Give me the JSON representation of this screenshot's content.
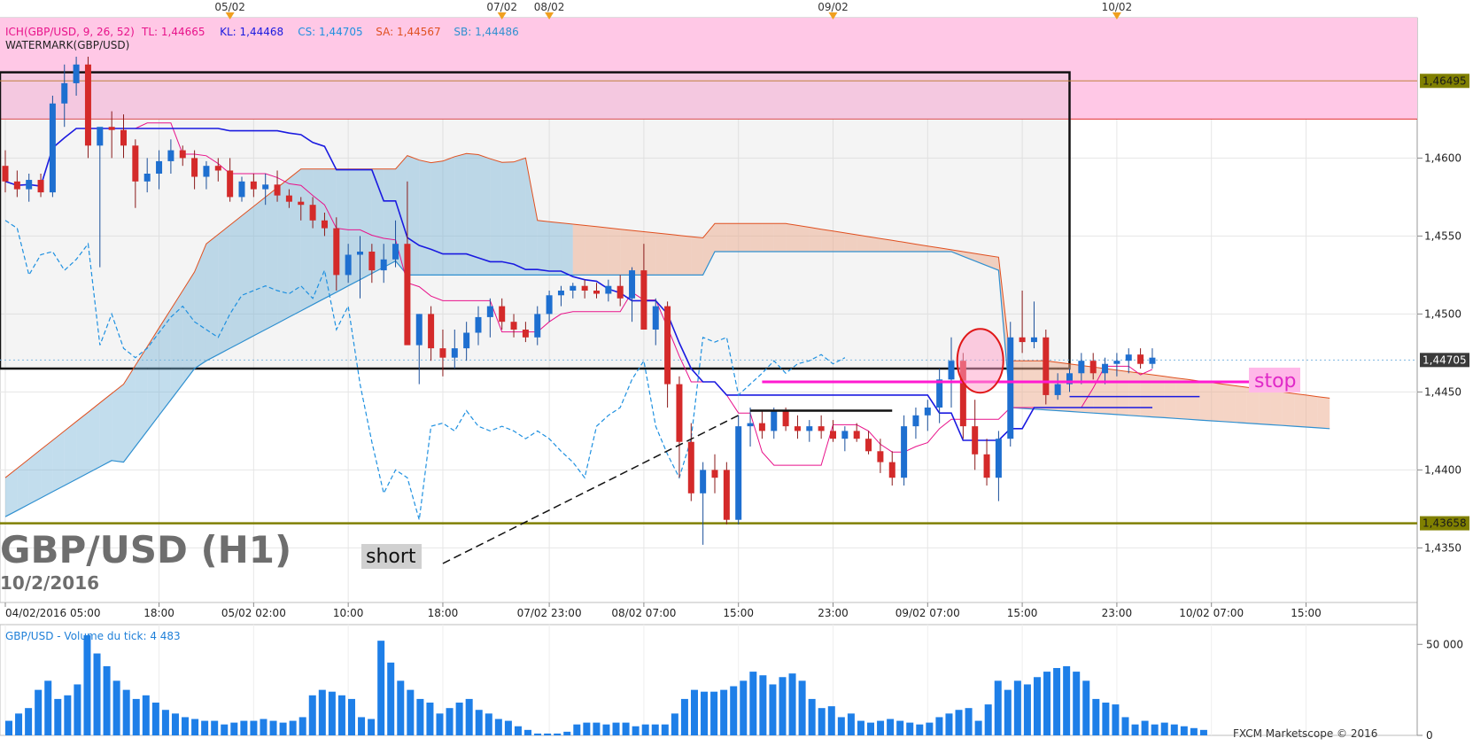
{
  "chart_data": {
    "type": "candlestick",
    "symbol_title": "GBP/USD (H1)",
    "date_label": "10/2/2016",
    "indicator_line": {
      "name": "ICH(GBP/USD, 9, 26, 52)",
      "items": [
        {
          "label": "TL: 1,44665",
          "color": "#e8128a"
        },
        {
          "label": "KL: 1,44468",
          "color": "#1a1ae0"
        },
        {
          "label": "CS: 1,44705",
          "color": "#1e90e0"
        },
        {
          "label": "SA: 1,44567",
          "color": "#e05020"
        },
        {
          "label": "SB: 1,44486",
          "color": "#3090d0"
        }
      ]
    },
    "watermark_label": "WATERMARK(GBP/USD)",
    "y_axis": {
      "min": 1.4315,
      "max": 1.469,
      "ticks": [
        "1,4350",
        "1,4400",
        "1,4450",
        "1,4500",
        "1,4550",
        "1,4600"
      ],
      "tick_values": [
        1.435,
        1.44,
        1.445,
        1.45,
        1.455,
        1.46
      ]
    },
    "price_tags": [
      {
        "label": "1,46495",
        "value": 1.46495,
        "style": "olive"
      },
      {
        "label": "1,44705",
        "value": 1.44705,
        "style": "dark"
      },
      {
        "label": "1,43658",
        "value": 1.43658,
        "style": "olive"
      }
    ],
    "x_axis_labels": [
      {
        "label": "04/02/2016 05:00",
        "bar": 0
      },
      {
        "label": "18:00",
        "bar": 13
      },
      {
        "label": "05/02 02:00",
        "bar": 21
      },
      {
        "label": "10:00",
        "bar": 29
      },
      {
        "label": "18:00",
        "bar": 37
      },
      {
        "label": "07/02 23:00",
        "bar": 46
      },
      {
        "label": "08/02 07:00",
        "bar": 54
      },
      {
        "label": "15:00",
        "bar": 62
      },
      {
        "label": "23:00",
        "bar": 70
      },
      {
        "label": "09/02 07:00",
        "bar": 78
      },
      {
        "label": "15:00",
        "bar": 86
      },
      {
        "label": "23:00",
        "bar": 94
      },
      {
        "label": "10/02 07:00",
        "bar": 102
      },
      {
        "label": "15:00",
        "bar": 110
      }
    ],
    "top_date_markers": [
      {
        "label": "05/02",
        "bar": 19
      },
      {
        "label": "07/02",
        "bar": 42
      },
      {
        "label": "08/02",
        "bar": 46
      },
      {
        "label": "09/02",
        "bar": 70
      },
      {
        "label": "10/02",
        "bar": 94
      }
    ],
    "candles_ohlc": [
      [
        1.4595,
        1.4605,
        1.4578,
        1.4585
      ],
      [
        1.4585,
        1.4592,
        1.4575,
        1.458
      ],
      [
        1.458,
        1.459,
        1.4572,
        1.4586
      ],
      [
        1.4586,
        1.459,
        1.4575,
        1.4578
      ],
      [
        1.4578,
        1.464,
        1.4575,
        1.4635
      ],
      [
        1.4635,
        1.466,
        1.462,
        1.4648
      ],
      [
        1.4648,
        1.4665,
        1.464,
        1.466
      ],
      [
        1.466,
        1.4665,
        1.46,
        1.4608
      ],
      [
        1.4608,
        1.4618,
        1.453,
        1.462
      ],
      [
        1.462,
        1.463,
        1.46,
        1.4618
      ],
      [
        1.4618,
        1.4628,
        1.46,
        1.4608
      ],
      [
        1.4608,
        1.4612,
        1.4568,
        1.4585
      ],
      [
        1.4585,
        1.46,
        1.4578,
        1.459
      ],
      [
        1.459,
        1.4605,
        1.458,
        1.4598
      ],
      [
        1.4598,
        1.4612,
        1.459,
        1.4605
      ],
      [
        1.4605,
        1.4608,
        1.4595,
        1.46
      ],
      [
        1.46,
        1.4605,
        1.458,
        1.4588
      ],
      [
        1.4588,
        1.4598,
        1.458,
        1.4595
      ],
      [
        1.4595,
        1.46,
        1.4585,
        1.4592
      ],
      [
        1.4592,
        1.46,
        1.4572,
        1.4575
      ],
      [
        1.4575,
        1.4588,
        1.4572,
        1.4585
      ],
      [
        1.4585,
        1.459,
        1.4575,
        1.458
      ],
      [
        1.458,
        1.459,
        1.457,
        1.4583
      ],
      [
        1.4583,
        1.4592,
        1.4572,
        1.4576
      ],
      [
        1.4576,
        1.458,
        1.4568,
        1.4572
      ],
      [
        1.4572,
        1.4575,
        1.456,
        1.457
      ],
      [
        1.457,
        1.4575,
        1.4555,
        1.456
      ],
      [
        1.456,
        1.4565,
        1.455,
        1.4555
      ],
      [
        1.4555,
        1.4562,
        1.4515,
        1.4525
      ],
      [
        1.4525,
        1.4545,
        1.452,
        1.4538
      ],
      [
        1.4538,
        1.455,
        1.451,
        1.454
      ],
      [
        1.454,
        1.4545,
        1.452,
        1.4528
      ],
      [
        1.4528,
        1.4545,
        1.452,
        1.4535
      ],
      [
        1.4535,
        1.456,
        1.453,
        1.4545
      ],
      [
        1.4545,
        1.4585,
        1.452,
        1.448
      ],
      [
        1.448,
        1.45,
        1.4455,
        1.45
      ],
      [
        1.45,
        1.4505,
        1.447,
        1.4478
      ],
      [
        1.4478,
        1.449,
        1.446,
        1.4472
      ],
      [
        1.4472,
        1.449,
        1.4465,
        1.4478
      ],
      [
        1.4478,
        1.4495,
        1.447,
        1.4488
      ],
      [
        1.4488,
        1.4505,
        1.448,
        1.4498
      ],
      [
        1.4498,
        1.451,
        1.4485,
        1.4505
      ],
      [
        1.4505,
        1.451,
        1.449,
        1.4495
      ],
      [
        1.4495,
        1.45,
        1.4485,
        1.449
      ],
      [
        1.449,
        1.4495,
        1.4482,
        1.4485
      ],
      [
        1.4485,
        1.4505,
        1.448,
        1.45
      ],
      [
        1.45,
        1.4515,
        1.4495,
        1.4512
      ],
      [
        1.4512,
        1.4518,
        1.4505,
        1.4515
      ],
      [
        1.4515,
        1.452,
        1.451,
        1.4518
      ],
      [
        1.4518,
        1.4522,
        1.451,
        1.4515
      ],
      [
        1.4515,
        1.452,
        1.451,
        1.4513
      ],
      [
        1.4513,
        1.4522,
        1.4508,
        1.4518
      ],
      [
        1.4518,
        1.4525,
        1.4505,
        1.451
      ],
      [
        1.451,
        1.453,
        1.4495,
        1.4528
      ],
      [
        1.4528,
        1.4545,
        1.4505,
        1.449
      ],
      [
        1.449,
        1.451,
        1.448,
        1.4505
      ],
      [
        1.4505,
        1.4508,
        1.444,
        1.4455
      ],
      [
        1.4455,
        1.446,
        1.4395,
        1.4418
      ],
      [
        1.4418,
        1.443,
        1.438,
        1.4385
      ],
      [
        1.4385,
        1.4405,
        1.4352,
        1.44
      ],
      [
        1.44,
        1.441,
        1.4385,
        1.4395
      ],
      [
        1.44,
        1.4405,
        1.4365,
        1.4368
      ],
      [
        1.4368,
        1.4435,
        1.4365,
        1.4428
      ],
      [
        1.4428,
        1.444,
        1.4415,
        1.443
      ],
      [
        1.443,
        1.4438,
        1.442,
        1.4425
      ],
      [
        1.4425,
        1.444,
        1.442,
        1.4438
      ],
      [
        1.4438,
        1.444,
        1.4425,
        1.4428
      ],
      [
        1.4428,
        1.4435,
        1.442,
        1.4425
      ],
      [
        1.4425,
        1.4432,
        1.4418,
        1.4428
      ],
      [
        1.4428,
        1.4435,
        1.442,
        1.4425
      ],
      [
        1.4425,
        1.4432,
        1.4418,
        1.442
      ],
      [
        1.442,
        1.4428,
        1.4412,
        1.4425
      ],
      [
        1.4425,
        1.443,
        1.4418,
        1.442
      ],
      [
        1.442,
        1.4425,
        1.441,
        1.4412
      ],
      [
        1.4412,
        1.442,
        1.4398,
        1.4405
      ],
      [
        1.4405,
        1.4412,
        1.439,
        1.4395
      ],
      [
        1.4395,
        1.4435,
        1.439,
        1.4428
      ],
      [
        1.4428,
        1.444,
        1.442,
        1.4435
      ],
      [
        1.4435,
        1.4445,
        1.4425,
        1.444
      ],
      [
        1.444,
        1.4465,
        1.443,
        1.4458
      ],
      [
        1.4458,
        1.4485,
        1.444,
        1.447
      ],
      [
        1.447,
        1.4475,
        1.442,
        1.4428
      ],
      [
        1.4428,
        1.4445,
        1.44,
        1.441
      ],
      [
        1.441,
        1.442,
        1.439,
        1.4395
      ],
      [
        1.4395,
        1.4425,
        1.438,
        1.442
      ],
      [
        1.442,
        1.4495,
        1.4415,
        1.4485
      ],
      [
        1.4485,
        1.4515,
        1.4475,
        1.4482
      ],
      [
        1.4482,
        1.4508,
        1.4478,
        1.4485
      ],
      [
        1.4485,
        1.449,
        1.4442,
        1.4448
      ],
      [
        1.4448,
        1.4462,
        1.4445,
        1.4455
      ],
      [
        1.4455,
        1.4465,
        1.445,
        1.4462
      ],
      [
        1.4462,
        1.4475,
        1.4455,
        1.447
      ],
      [
        1.447,
        1.4475,
        1.4458,
        1.4462
      ],
      [
        1.4462,
        1.4472,
        1.4455,
        1.4468
      ],
      [
        1.4468,
        1.4475,
        1.446,
        1.447
      ],
      [
        1.447,
        1.4478,
        1.4462,
        1.4474
      ],
      [
        1.4474,
        1.4478,
        1.4465,
        1.4468
      ],
      [
        1.4468,
        1.4478,
        1.4465,
        1.4472
      ]
    ],
    "volume_label": "GBP/USD - Volume du tick: 4 483",
    "volume_axis": {
      "max": 55,
      "ticks": [
        "50 000",
        "0"
      ],
      "tick_values": [
        50,
        0
      ]
    },
    "volumes": [
      8,
      12,
      15,
      25,
      30,
      20,
      22,
      28,
      55,
      45,
      38,
      30,
      25,
      20,
      22,
      18,
      14,
      12,
      10,
      9,
      8,
      8,
      6,
      7,
      8,
      8,
      9,
      8,
      7,
      8,
      10,
      22,
      25,
      24,
      22,
      20,
      10,
      9,
      52,
      40,
      30,
      25,
      20,
      18,
      12,
      15,
      18,
      20,
      14,
      12,
      9,
      8,
      5,
      3,
      1,
      1,
      1,
      2,
      6,
      7,
      7,
      6,
      7,
      7,
      5,
      6,
      6,
      6,
      12,
      20,
      25,
      24,
      24,
      25,
      27,
      30,
      35,
      33,
      28,
      32,
      34,
      30,
      20,
      15,
      16,
      10,
      12,
      8,
      7,
      8,
      9,
      8,
      7,
      6,
      7,
      10,
      12,
      14,
      15,
      8,
      17,
      30,
      25,
      30,
      28,
      32,
      35,
      37,
      38,
      35,
      30,
      20,
      18,
      17,
      10,
      6,
      8,
      6,
      7,
      6,
      5,
      4,
      3
    ],
    "annotations": [
      {
        "text": "short"
      },
      {
        "text": "stop"
      }
    ],
    "footer": "FXCM Marketscope © 2016"
  }
}
